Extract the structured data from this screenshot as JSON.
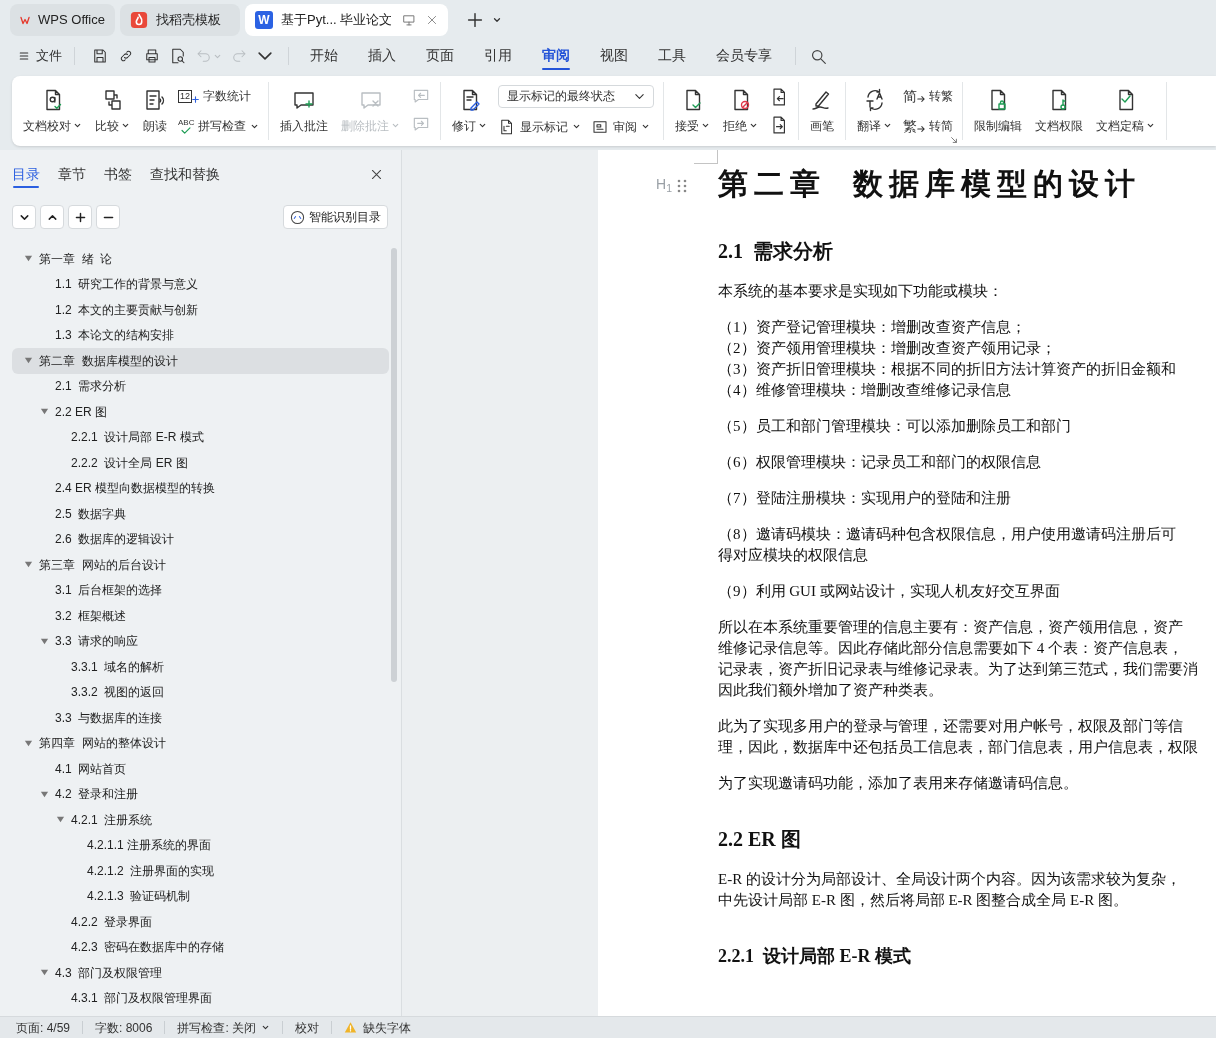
{
  "title_bar": {
    "tabs": [
      {
        "kind": "home",
        "label": "WPS Office",
        "selected": false
      },
      {
        "kind": "template",
        "label": "找稻壳模板",
        "selected": false
      },
      {
        "kind": "document",
        "glyph": "W",
        "label": "基于Pyt... 毕业论文",
        "selected": true
      }
    ]
  },
  "menu_bar": {
    "file_label": "文件",
    "quick_tools": [
      {
        "caret": false,
        "disabled": false
      },
      {
        "caret": false,
        "disabled": false
      },
      {
        "caret": false,
        "disabled": false
      },
      {
        "caret": false,
        "disabled": false
      },
      {
        "caret": true,
        "disabled": true
      },
      {
        "caret": false,
        "disabled": true
      },
      {
        "caret": false,
        "disabled": false
      }
    ],
    "tabs": [
      {
        "label": "开始",
        "selected": false
      },
      {
        "label": "插入",
        "selected": false
      },
      {
        "label": "页面",
        "selected": false
      },
      {
        "label": "引用",
        "selected": false
      },
      {
        "label": "审阅",
        "selected": true
      },
      {
        "label": "视图",
        "selected": false
      },
      {
        "label": "工具",
        "selected": false
      },
      {
        "label": "会员专享",
        "selected": false
      }
    ]
  },
  "ribbon": [
    {
      "items": [
        {
          "kind": "large",
          "label": "文档校对",
          "caret": true,
          "disabled": false
        },
        {
          "kind": "large",
          "label": "比较",
          "caret": true,
          "disabled": false
        },
        {
          "kind": "large",
          "label": "朗读",
          "caret": false,
          "disabled": false
        },
        {
          "kind": "stack",
          "rows": [
            [
              {
                "kind": "small",
                "glyph": "12",
                "label": "字数统计",
                "caret": false,
                "disabled": false
              }
            ],
            [
              {
                "kind": "small",
                "glyph": "ABC",
                "label": "拼写检查",
                "caret": true,
                "disabled": false
              }
            ]
          ]
        }
      ]
    },
    {
      "items": [
        {
          "kind": "large",
          "label": "插入批注",
          "caret": false,
          "disabled": false
        },
        {
          "kind": "large",
          "label": "删除批注",
          "caret": true,
          "disabled": true
        },
        {
          "kind": "stack",
          "rows": [
            [
              {
                "kind": "icon",
                "disabled": true
              }
            ],
            [
              {
                "kind": "icon",
                "disabled": true
              }
            ]
          ]
        }
      ]
    },
    {
      "items": [
        {
          "kind": "large",
          "label": "修订",
          "caret": true,
          "disabled": false
        },
        {
          "kind": "stack",
          "rows": [
            [
              {
                "kind": "dropdown",
                "label": "显示标记的最终状态",
                "disabled": false
              }
            ],
            [
              {
                "kind": "small",
                "label": "显示标记",
                "caret": true,
                "disabled": false
              },
              {
                "kind": "small",
                "label": "审阅",
                "caret": true,
                "disabled": false
              }
            ]
          ]
        }
      ]
    },
    {
      "items": [
        {
          "kind": "large",
          "label": "接受",
          "caret": true,
          "disabled": false
        },
        {
          "kind": "large",
          "label": "拒绝",
          "caret": true,
          "disabled": false
        },
        {
          "kind": "stack",
          "rows": [
            [
              {
                "kind": "icon",
                "disabled": false
              }
            ],
            [
              {
                "kind": "icon",
                "disabled": false
              }
            ]
          ]
        }
      ]
    },
    {
      "items": [
        {
          "kind": "large",
          "label": "画笔",
          "caret": false,
          "disabled": false
        }
      ]
    },
    {
      "launcher": true,
      "items": [
        {
          "kind": "large",
          "label": "翻译",
          "caret": true,
          "disabled": false
        },
        {
          "kind": "stack",
          "rows": [
            [
              {
                "kind": "small",
                "glyph": "简",
                "label": "转繁",
                "caret": false,
                "disabled": false
              }
            ],
            [
              {
                "kind": "small",
                "glyph": "繁",
                "label": "转简",
                "caret": false,
                "disabled": false
              }
            ]
          ]
        }
      ]
    },
    {
      "items": [
        {
          "kind": "large",
          "label": "限制编辑",
          "caret": false,
          "disabled": false
        },
        {
          "kind": "large",
          "label": "文档权限",
          "caret": false,
          "disabled": false
        },
        {
          "kind": "large",
          "label": "文档定稿",
          "caret": true,
          "disabled": false
        }
      ]
    }
  ],
  "navigation_pane": {
    "tabs": [
      {
        "label": "目录",
        "selected": true
      },
      {
        "label": "章节",
        "selected": false
      },
      {
        "label": "书签",
        "selected": false
      },
      {
        "label": "查找和替换",
        "selected": false
      }
    ],
    "smart_button": "智能识别目录",
    "outline": [
      {
        "label": "第一章  绪  论",
        "selected": false,
        "expanded": true,
        "children": [
          {
            "label": "1.1  研究工作的背景与意义",
            "selected": false
          },
          {
            "label": "1.2  本文的主要贡献与创新",
            "selected": false
          },
          {
            "label": "1.3  本论文的结构安排",
            "selected": false
          }
        ]
      },
      {
        "label": "第二章  数据库模型的设计",
        "selected": true,
        "expanded": true,
        "children": [
          {
            "label": "2.1  需求分析",
            "selected": false
          },
          {
            "label": "2.2 ER 图",
            "selected": false,
            "expanded": true,
            "children": [
              {
                "label": "2.2.1  设计局部 E-R 模式",
                "selected": false
              },
              {
                "label": "2.2.2  设计全局 ER 图",
                "selected": false
              }
            ]
          },
          {
            "label": "2.4 ER 模型向数据模型的转换",
            "selected": false
          },
          {
            "label": "2.5  数据字典",
            "selected": false
          },
          {
            "label": "2.6  数据库的逻辑设计",
            "selected": false
          }
        ]
      },
      {
        "label": "第三章  网站的后台设计",
        "selected": false,
        "expanded": true,
        "children": [
          {
            "label": "3.1  后台框架的选择",
            "selected": false
          },
          {
            "label": "3.2  框架概述",
            "selected": false
          },
          {
            "label": "3.3  请求的响应",
            "selected": false,
            "expanded": true,
            "children": [
              {
                "label": "3.3.1  域名的解析",
                "selected": false
              },
              {
                "label": "3.3.2  视图的返回",
                "selected": false
              }
            ]
          },
          {
            "label": "3.3  与数据库的连接",
            "selected": false
          }
        ]
      },
      {
        "label": "第四章  网站的整体设计",
        "selected": false,
        "expanded": true,
        "children": [
          {
            "label": "4.1  网站首页",
            "selected": false
          },
          {
            "label": "4.2  登录和注册",
            "selected": false,
            "expanded": true,
            "children": [
              {
                "label": "4.2.1  注册系统",
                "selected": false,
                "expanded": true,
                "children": [
                  {
                    "label": "4.2.1.1 注册系统的界面",
                    "selected": false
                  },
                  {
                    "label": "4.2.1.2  注册界面的实现",
                    "selected": false
                  },
                  {
                    "label": "4.2.1.3  验证码机制",
                    "selected": false
                  }
                ]
              },
              {
                "label": "4.2.2  登录界面",
                "selected": false
              },
              {
                "label": "4.2.3  密码在数据库中的存储",
                "selected": false
              }
            ]
          },
          {
            "label": "4.3  部门及权限管理",
            "selected": false,
            "expanded": true,
            "children": [
              {
                "label": "4.3.1  部门及权限管理界面",
                "selected": false
              }
            ]
          }
        ]
      }
    ]
  },
  "document": {
    "heading_marker": "H$_{1}$",
    "blocks": [
      {
        "kind": "chapter",
        "lines": [
          "第二章  数据库模型的设计"
        ]
      },
      {
        "kind": "heading",
        "lines": [
          "2.1  需求分析"
        ]
      },
      {
        "kind": "para",
        "lines": [
          "本系统的基本要求是实现如下功能或模块："
        ]
      },
      {
        "kind": "para",
        "lines": [
          "（1）资产登记管理模块：增删改查资产信息；",
          "（2）资产领用管理模块：增删改查资产领用记录；",
          "（3）资产折旧管理模块：根据不同的折旧方法计算资产的折旧金额和",
          "（4）维修管理模块：增删改查维修记录信息"
        ]
      },
      {
        "kind": "para",
        "lines": [
          "（5）员工和部门管理模块：可以添加删除员工和部门"
        ]
      },
      {
        "kind": "para",
        "lines": [
          "（6）权限管理模块：记录员工和部门的权限信息"
        ]
      },
      {
        "kind": "para",
        "lines": [
          "（7）登陆注册模块：实现用户的登陆和注册"
        ]
      },
      {
        "kind": "para",
        "lines": [
          "（8）邀请码模块：邀请码种包含权限信息，用户使用邀请码注册后可",
          "得对应模块的权限信息"
        ]
      },
      {
        "kind": "para",
        "lines": [
          "（9）利用 GUI 或网站设计，实现人机友好交互界面"
        ]
      },
      {
        "kind": "para",
        "lines": [
          "所以在本系统重要管理的信息主要有：资产信息，资产领用信息，资产",
          "维修记录信息等。因此存储此部分信息需要如下 4 个表：资产信息表，",
          "记录表，资产折旧记录表与维修记录表。为了达到第三范式，我们需要消",
          "因此我们额外增加了资产种类表。"
        ]
      },
      {
        "kind": "para",
        "lines": [
          "此为了实现多用户的登录与管理，还需要对用户帐号，权限及部门等信",
          "理，因此，数据库中还包括员工信息表，部门信息表，用户信息表，权限"
        ]
      },
      {
        "kind": "para",
        "lines": [
          "为了实现邀请码功能，添加了表用来存储邀请码信息。"
        ]
      },
      {
        "kind": "heading",
        "lines": [
          "2.2 ER 图"
        ]
      },
      {
        "kind": "para",
        "lines": [
          "E-R 的设计分为局部设计、全局设计两个内容。因为该需求较为复杂，",
          "中先设计局部 E-R 图，然后将局部 E-R 图整合成全局 E-R 图。"
        ]
      },
      {
        "kind": "subheading",
        "lines": [
          "2.2.1  设计局部 E-R 模式"
        ]
      }
    ]
  },
  "status_bar": [
    {
      "kind": "text",
      "label": "页面: 4/59"
    },
    {
      "kind": "text",
      "label": "字数: 8006"
    },
    {
      "kind": "dropdown",
      "label": "拼写检查: 关闭"
    },
    {
      "kind": "text",
      "label": "校对"
    },
    {
      "kind": "warning",
      "label": "缺失字体"
    }
  ]
}
